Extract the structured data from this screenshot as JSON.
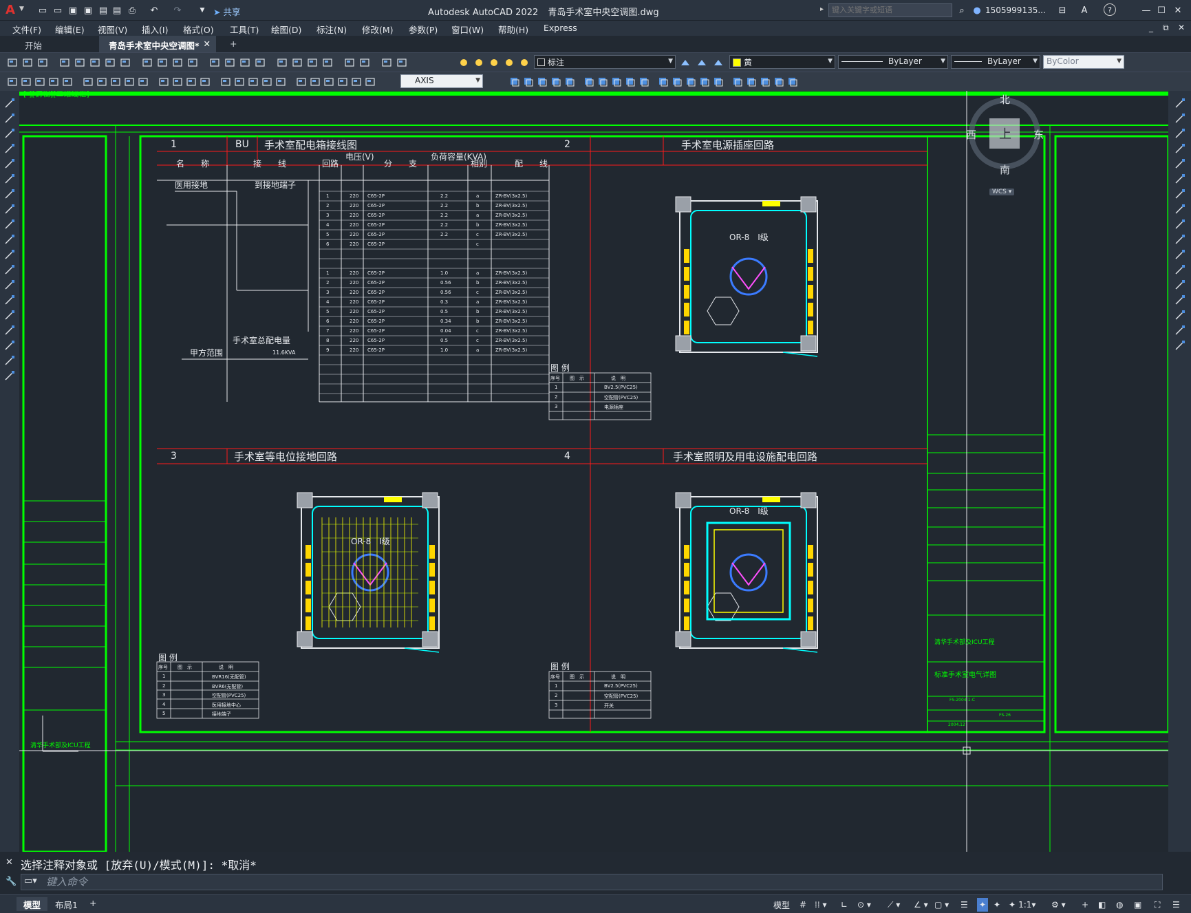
{
  "app": {
    "logo": "A",
    "title": "Autodesk AutoCAD 2022",
    "filename": "青岛手术室中央空调图.dwg",
    "share_label": "共享",
    "search_placeholder": "键入关键字或短语",
    "user": "1505999135...",
    "help_label": "?"
  },
  "menu": {
    "items": [
      "文件(F)",
      "编辑(E)",
      "视图(V)",
      "插入(I)",
      "格式(O)",
      "工具(T)",
      "绘图(D)",
      "标注(N)",
      "修改(M)",
      "参数(P)",
      "窗口(W)",
      "帮助(H)",
      "Express"
    ]
  },
  "tabs": {
    "start": "开始",
    "active": "青岛手术室中央空调图*",
    "new": "+"
  },
  "toolbar": {
    "dimstyle": "标注",
    "color": "黄",
    "linetype": "ByLayer",
    "lineweight": "ByLayer",
    "plotstyle": "ByColor",
    "layer": "AXIS"
  },
  "viewcube": {
    "north": "北",
    "south": "南",
    "east": "东",
    "west": "西",
    "face": "上",
    "wcs": "WCS"
  },
  "drawing": {
    "frame_label": "[-][俯视][二维线框]",
    "panel1": {
      "num": "1",
      "code": "BU",
      "title": "手术室配电箱接线图"
    },
    "panel2": {
      "num": "2",
      "title": "手术室电源插座回路"
    },
    "panel3": {
      "num": "3",
      "title": "手术室等电位接地回路"
    },
    "panel4": {
      "num": "4",
      "title": "手术室照明及用电设施配电回路"
    },
    "table1": {
      "headers": [
        "名　　称",
        "接　　线",
        "回路",
        "电压(V)",
        "分　　支",
        "负荷容量(KVA)",
        "相别",
        "配　　线"
      ],
      "rows": [
        [
          "1",
          "220",
          "C65-2P",
          "2.2",
          "a",
          "ZR-BV(3x2.5)"
        ],
        [
          "2",
          "220",
          "C65-2P",
          "2.2",
          "b",
          "ZR-BV(3x2.5)"
        ],
        [
          "3",
          "220",
          "C65-2P",
          "2.2",
          "a",
          "ZR-BV(3x2.5)"
        ],
        [
          "4",
          "220",
          "C65-2P",
          "2.2",
          "b",
          "ZR-BV(3x2.5)"
        ],
        [
          "5",
          "220",
          "C65-2P",
          "2.2",
          "c",
          "ZR-BV(3x2.5)"
        ],
        [
          "6",
          "220",
          "C65-2P",
          "",
          "c",
          ""
        ]
      ],
      "rows2": [
        [
          "1",
          "220",
          "C65-2P",
          "1.0",
          "a",
          "ZR-BV(3x2.5)"
        ],
        [
          "2",
          "220",
          "C65-2P",
          "0.56",
          "b",
          "ZR-BV(3x2.5)"
        ],
        [
          "3",
          "220",
          "C65-2P",
          "0.56",
          "c",
          "ZR-BV(3x2.5)"
        ],
        [
          "4",
          "220",
          "C65-2P",
          "0.3",
          "a",
          "ZR-BV(3x2.5)"
        ],
        [
          "5",
          "220",
          "C65-2P",
          "0.5",
          "b",
          "ZR-BV(3x2.5)"
        ],
        [
          "6",
          "220",
          "C65-2P",
          "0.34",
          "b",
          "ZR-BV(3x2.5)"
        ],
        [
          "7",
          "220",
          "C65-2P",
          "0.04",
          "c",
          "ZR-BV(3x2.5)"
        ],
        [
          "8",
          "220",
          "C65-2P",
          "0.5",
          "c",
          "ZR-BV(3x2.5)"
        ],
        [
          "9",
          "220",
          "C65-2P",
          "1.0",
          "a",
          "ZR-BV(3x2.5)"
        ]
      ],
      "label_ground": "医用接地",
      "label_terminal": "到接地端子",
      "label_total": "手术室总配电量",
      "label_scope": "甲方范围",
      "total_value": "11.6KVA"
    },
    "legend_title": "图  例",
    "legend_headers": [
      "序号",
      "图　示",
      "说　明"
    ],
    "legend2": [
      "BV2.5(PVC25)",
      "空配管(PVC25)",
      "电源插座"
    ],
    "legend3": [
      "BVR16(无配管)",
      "BVR6(无配管)",
      "空配管(PVC25)",
      "医用接地中心",
      "接地端子"
    ],
    "legend4": [
      "BV2.5(PVC25)",
      "空配管(PVC25)",
      "开关"
    ],
    "room_label": "OR-8　I级",
    "titleblock": {
      "project": "清华手术部及ICU工程",
      "sheet_title": "标准手术室电气详图",
      "drawing_no": "FS-2004-1-C",
      "date": "2004.12",
      "page": "FS-26"
    }
  },
  "command": {
    "history": "选择注释对象或 [放弃(U)/模式(M)]: *取消*",
    "placeholder": "键入命令"
  },
  "status": {
    "model": "模型",
    "layout1": "布局1",
    "add": "+",
    "model_btn": "模型",
    "scale": "1:1"
  }
}
